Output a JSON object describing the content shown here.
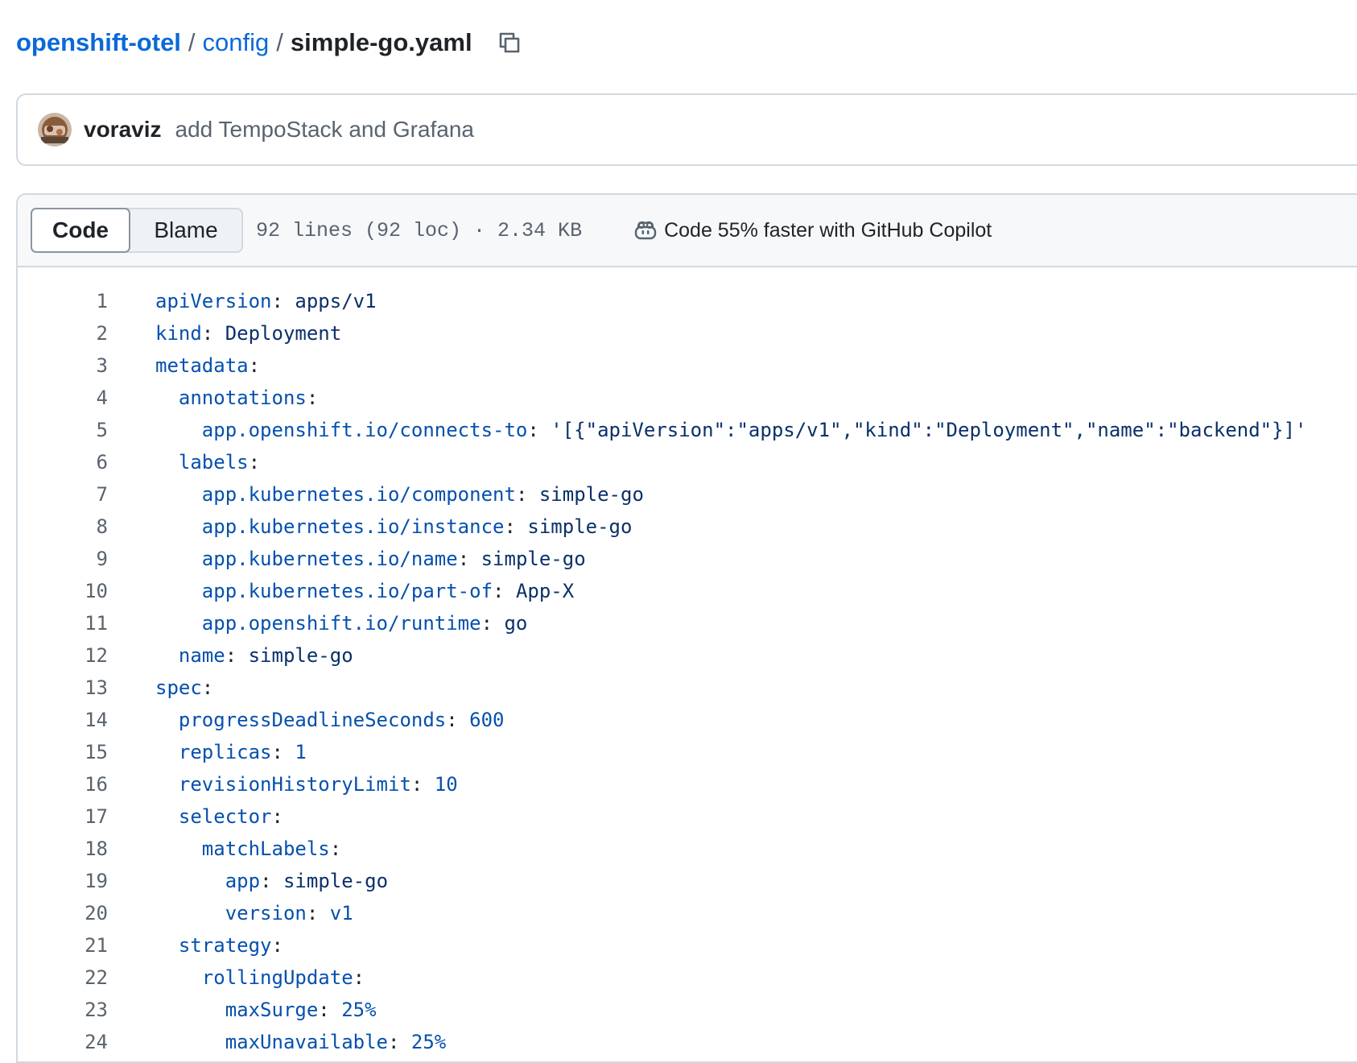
{
  "breadcrumb": {
    "repo": "openshift-otel",
    "folder": "config",
    "file": "simple-go.yaml",
    "separator": "/"
  },
  "commit": {
    "author": "voraviz",
    "message": "add TempoStack and Grafana"
  },
  "file_header": {
    "tabs": [
      "Code",
      "Blame"
    ],
    "active_tab": "Code",
    "stats": "92 lines (92 loc) · 2.34 KB",
    "copilot_text": "Code 55% faster with GitHub Copilot",
    "copilot_icon": "copilot-icon"
  },
  "colors": {
    "link": "#0969da",
    "yaml_key": "#0550ae",
    "yaml_value": "#0a3069",
    "line_number": "#59636e",
    "border": "#d1d9e0",
    "header_bg": "#f6f8fa"
  },
  "code_lines": [
    {
      "n": "1",
      "indent": 0,
      "key": "apiVersion",
      "value": "apps/v1",
      "vtype": "s"
    },
    {
      "n": "2",
      "indent": 0,
      "key": "kind",
      "value": "Deployment",
      "vtype": "s"
    },
    {
      "n": "3",
      "indent": 0,
      "key": "metadata",
      "value": "",
      "vtype": "s"
    },
    {
      "n": "4",
      "indent": 1,
      "key": "annotations",
      "value": "",
      "vtype": "s"
    },
    {
      "n": "5",
      "indent": 2,
      "key": "app.openshift.io/connects-to",
      "value": "'[{\"apiVersion\":\"apps/v1\",\"kind\":\"Deployment\",\"name\":\"backend\"}]'",
      "vtype": "s"
    },
    {
      "n": "6",
      "indent": 1,
      "key": "labels",
      "value": "",
      "vtype": "s"
    },
    {
      "n": "7",
      "indent": 2,
      "key": "app.kubernetes.io/component",
      "value": "simple-go",
      "vtype": "s"
    },
    {
      "n": "8",
      "indent": 2,
      "key": "app.kubernetes.io/instance",
      "value": "simple-go",
      "vtype": "s"
    },
    {
      "n": "9",
      "indent": 2,
      "key": "app.kubernetes.io/name",
      "value": "simple-go",
      "vtype": "s"
    },
    {
      "n": "10",
      "indent": 2,
      "key": "app.kubernetes.io/part-of",
      "value": "App-X",
      "vtype": "s"
    },
    {
      "n": "11",
      "indent": 2,
      "key": "app.openshift.io/runtime",
      "value": "go",
      "vtype": "s"
    },
    {
      "n": "12",
      "indent": 1,
      "key": "name",
      "value": "simple-go",
      "vtype": "s"
    },
    {
      "n": "13",
      "indent": 0,
      "key": "spec",
      "value": "",
      "vtype": "s"
    },
    {
      "n": "14",
      "indent": 1,
      "key": "progressDeadlineSeconds",
      "value": "600",
      "vtype": "n"
    },
    {
      "n": "15",
      "indent": 1,
      "key": "replicas",
      "value": "1",
      "vtype": "n"
    },
    {
      "n": "16",
      "indent": 1,
      "key": "revisionHistoryLimit",
      "value": "10",
      "vtype": "n"
    },
    {
      "n": "17",
      "indent": 1,
      "key": "selector",
      "value": "",
      "vtype": "s"
    },
    {
      "n": "18",
      "indent": 2,
      "key": "matchLabels",
      "value": "",
      "vtype": "s"
    },
    {
      "n": "19",
      "indent": 3,
      "key": "app",
      "value": "simple-go",
      "vtype": "s"
    },
    {
      "n": "20",
      "indent": 3,
      "key": "version",
      "value": "v1",
      "vtype": "n"
    },
    {
      "n": "21",
      "indent": 1,
      "key": "strategy",
      "value": "",
      "vtype": "s"
    },
    {
      "n": "22",
      "indent": 2,
      "key": "rollingUpdate",
      "value": "",
      "vtype": "s"
    },
    {
      "n": "23",
      "indent": 3,
      "key": "maxSurge",
      "value": "25%",
      "vtype": "n"
    },
    {
      "n": "24",
      "indent": 3,
      "key": "maxUnavailable",
      "value": "25%",
      "vtype": "n"
    }
  ]
}
